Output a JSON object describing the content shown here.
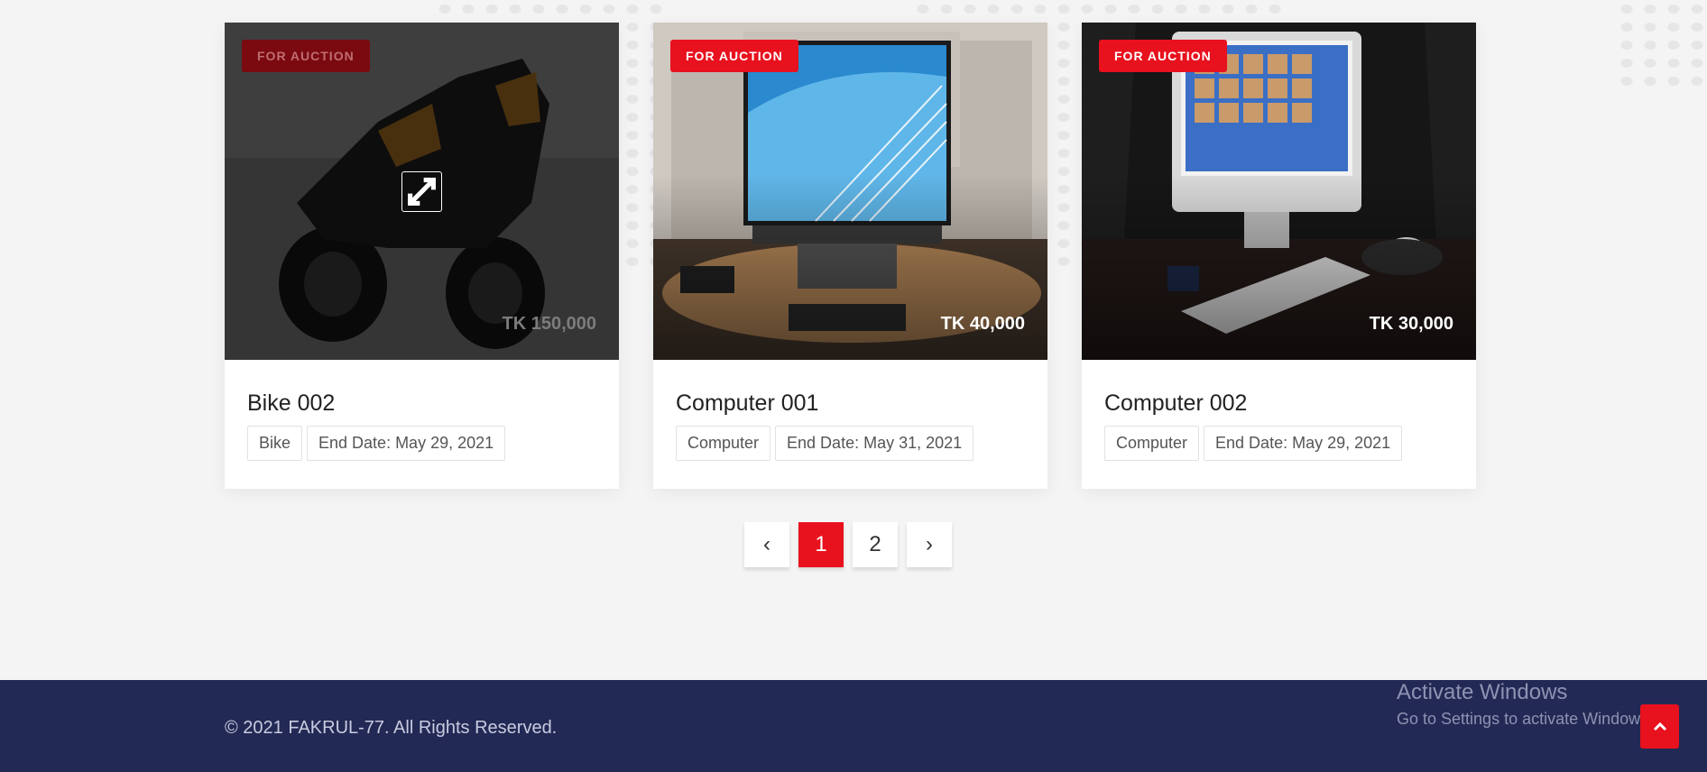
{
  "listings": [
    {
      "badge": "FOR AUCTION",
      "price": "TK 150,000",
      "title": "Bike 002",
      "category": "Bike",
      "end_date": "End Date: May 29, 2021",
      "image_icon": "motorcycle-image"
    },
    {
      "badge": "FOR AUCTION",
      "price": "TK 40,000",
      "title": "Computer 001",
      "category": "Computer",
      "end_date": "End Date: May 31, 2021",
      "image_icon": "all-in-one-computer-image"
    },
    {
      "badge": "FOR AUCTION",
      "price": "TK 30,000",
      "title": "Computer 002",
      "category": "Computer",
      "end_date": "End Date: May 29, 2021",
      "image_icon": "imac-computer-image"
    }
  ],
  "pagination": {
    "prev": "‹",
    "pages": [
      "1",
      "2"
    ],
    "active_page": "1",
    "next": "›"
  },
  "footer": {
    "copyright": "© 2021 FAKRUL-77. All Rights Reserved.",
    "scroll_top_icon": "chevron-up-icon"
  },
  "watermark": {
    "title": "Activate Windows",
    "subtitle": "Go to Settings to activate Windows."
  },
  "colors": {
    "accent": "#e8111e",
    "footer_bg": "#222954",
    "page_bg": "#f4f4f4"
  }
}
